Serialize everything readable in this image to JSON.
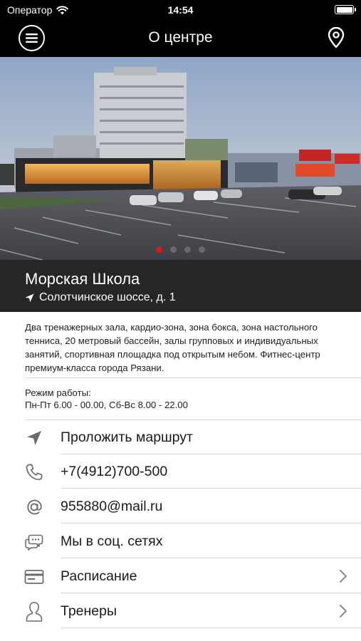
{
  "status_bar": {
    "carrier": "Оператор",
    "time": "14:54",
    "wifi_icon": "wifi-icon",
    "battery_icon": "battery-icon",
    "battery_level": 1.0
  },
  "nav": {
    "title": "О центре",
    "menu_icon": "hamburger-menu-icon",
    "map_icon": "map-pin-icon"
  },
  "gallery": {
    "image": "Photo of a fitness center building with a parking lot at dusk",
    "slide_count": 4,
    "active_index": 0
  },
  "place": {
    "name": "Морская Школа",
    "address": "Солотчинское шоссе, д. 1",
    "address_icon": "location-arrow-icon"
  },
  "description": "Два тренажерных зала, кардио-зона, зона бокса, зона настольного тенниса, 20 метровый бассейн, залы групповых и индивидуальных занятий, спортивная площадка под открытым небом. Фитнес-центр премиум-класса города Рязани.",
  "hours": {
    "label": "Режим работы:",
    "value": "Пн-Пт 6.00 - 00.00, Сб-Вс 8.00 - 22.00"
  },
  "actions": [
    {
      "label": "Проложить маршрут",
      "icon": "navigation-arrow-icon",
      "chevron": false
    },
    {
      "label": "+7(4912)700-500",
      "icon": "phone-icon",
      "chevron": false
    },
    {
      "label": "955880@mail.ru",
      "icon": "at-sign-icon",
      "chevron": false
    },
    {
      "label": "Мы в соц. сетях",
      "icon": "chat-bubbles-icon",
      "chevron": false
    },
    {
      "label": "Расписание",
      "icon": "schedule-card-icon",
      "chevron": true
    },
    {
      "label": "Тренеры",
      "icon": "trainer-person-icon",
      "chevron": true
    }
  ],
  "colors": {
    "bar_bg": "#000000",
    "place_bg": "#262626",
    "active_dot": "#d41a1a",
    "icon_gray": "#6b6b6b"
  }
}
